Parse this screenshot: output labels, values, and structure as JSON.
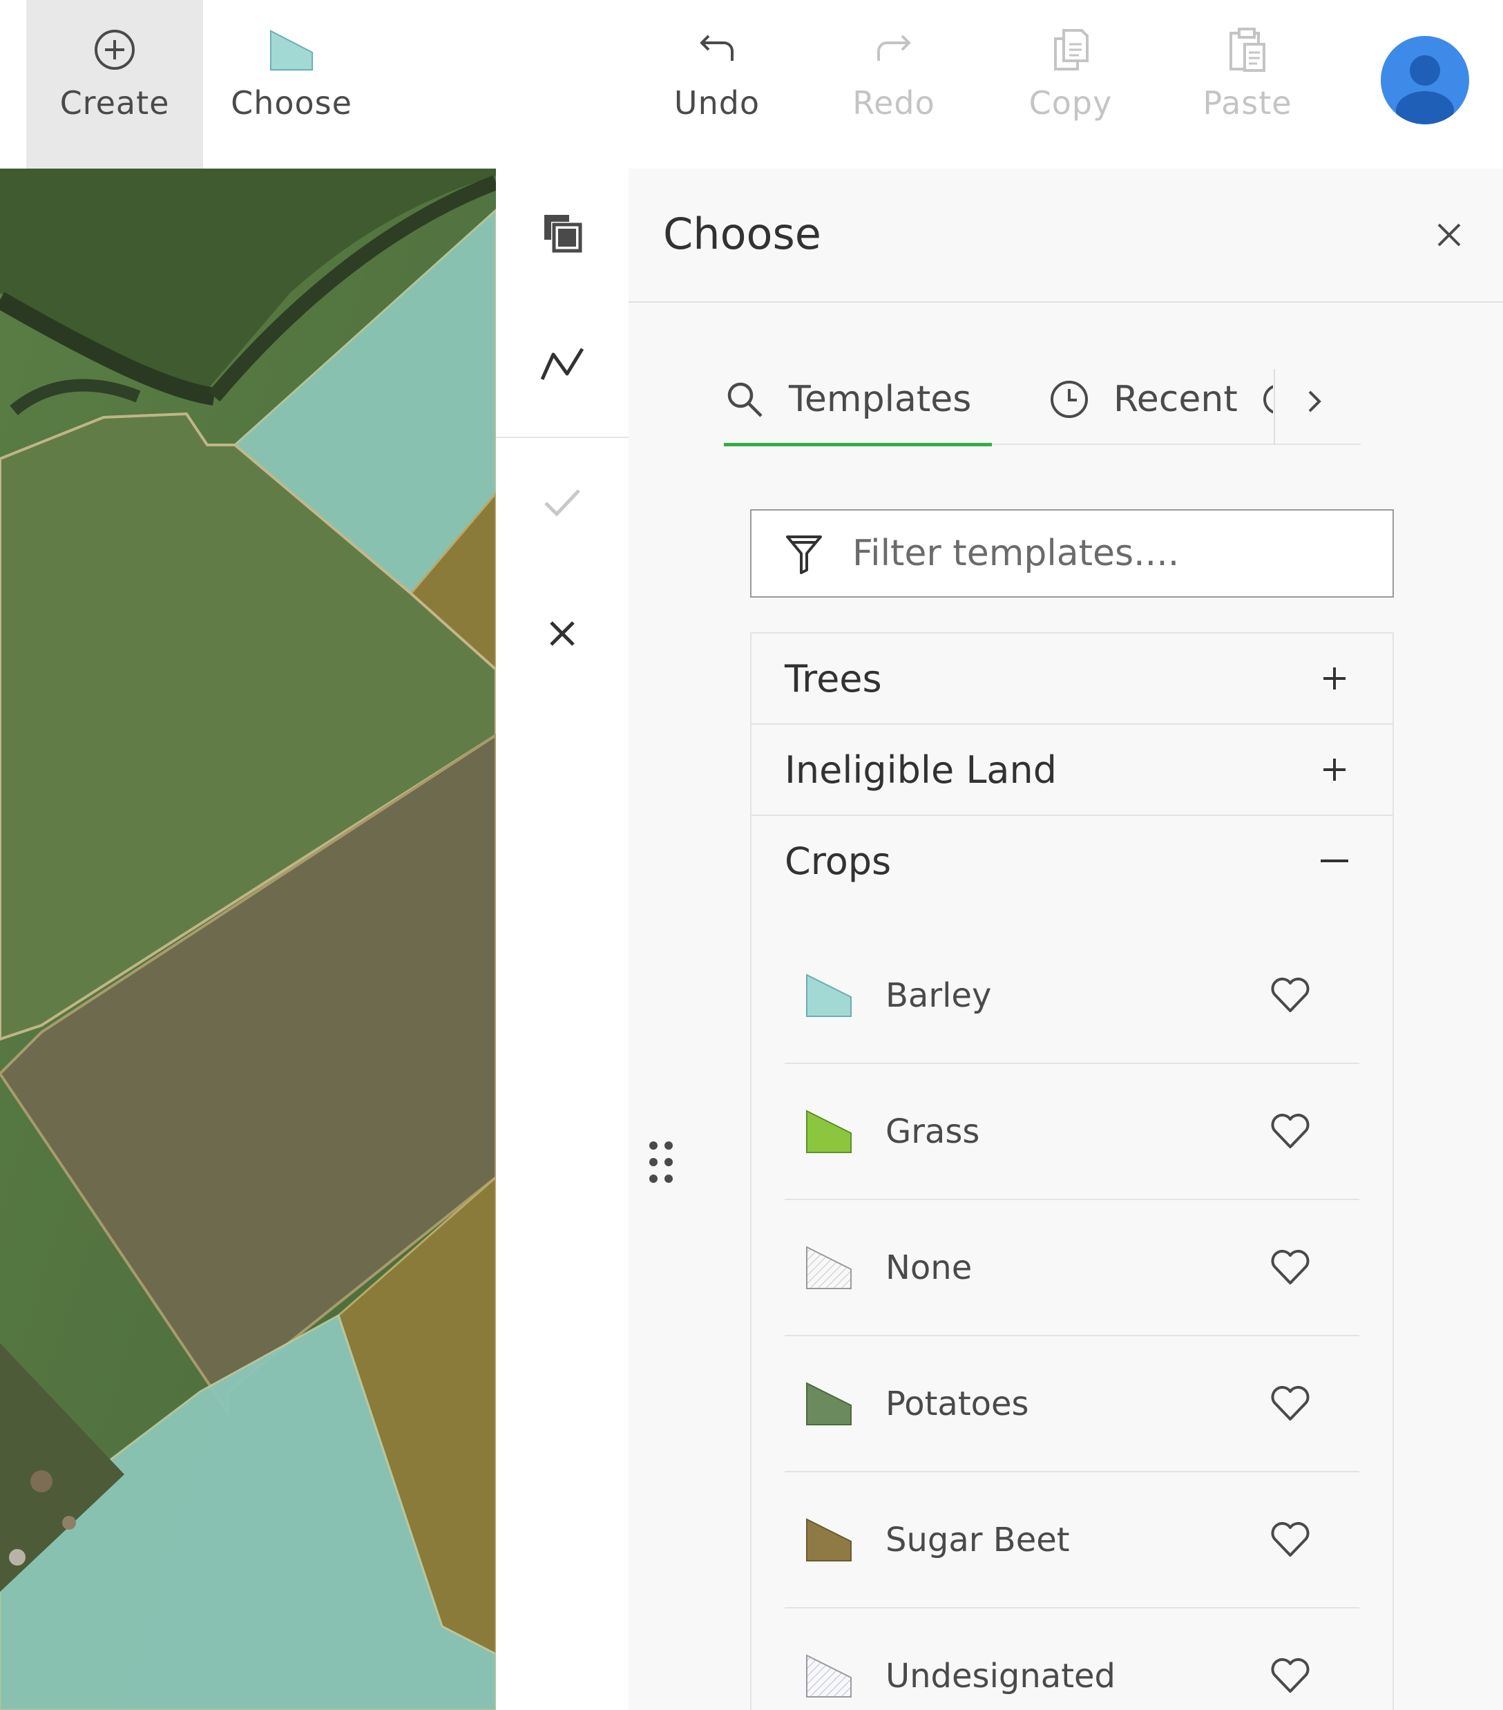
{
  "toolbar": {
    "create_label": "Create",
    "choose_label": "Choose",
    "undo_label": "Undo",
    "redo_label": "Redo",
    "copy_label": "Copy",
    "paste_label": "Paste",
    "choose_icon_color": "#a3d9d5"
  },
  "tool_strip": {
    "icons": [
      "duplicate-icon",
      "polyline-icon",
      "checkmark-icon",
      "close-icon"
    ]
  },
  "panel": {
    "title": "Choose",
    "tabs": [
      {
        "label": "Templates",
        "icon": "search-icon",
        "active": true
      },
      {
        "label": "Recent",
        "icon": "clock-icon",
        "active": false
      }
    ],
    "filter": {
      "placeholder": "Filter templates...."
    },
    "groups": [
      {
        "label": "Trees",
        "expanded": false
      },
      {
        "label": "Ineligible Land",
        "expanded": false
      },
      {
        "label": "Crops",
        "expanded": true,
        "items": [
          {
            "label": "Barley",
            "color": "#a3d9d5",
            "pattern": "solid"
          },
          {
            "label": "Grass",
            "color": "#8cc63f",
            "pattern": "solid"
          },
          {
            "label": "None",
            "color": "#c8c8c8",
            "pattern": "hatched"
          },
          {
            "label": "Potatoes",
            "color": "#6b8a5e",
            "pattern": "solid"
          },
          {
            "label": "Sugar Beet",
            "color": "#8f7a45",
            "pattern": "solid"
          },
          {
            "label": "Undesignated",
            "color": "#b9bde6",
            "pattern": "hatched"
          }
        ]
      }
    ]
  },
  "colors": {
    "accent": "#35ac46",
    "avatar": "#3d8ae8",
    "map_barley_fill": "#8cc6b8",
    "map_potatoes_fill": "#637d49",
    "map_sugarbeet_fill": "#8b7b3a",
    "map_soil_fill": "#6e6a4e"
  }
}
